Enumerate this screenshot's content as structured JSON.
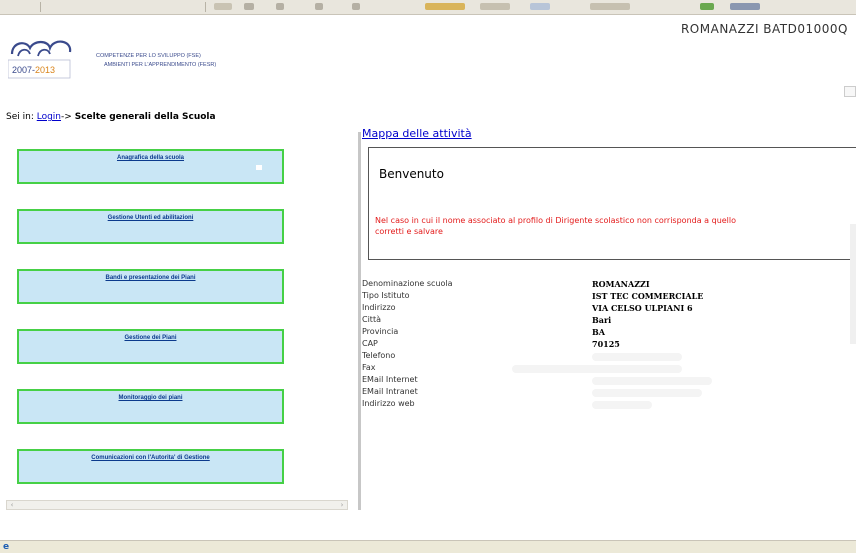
{
  "header": {
    "logo_years_a": "2007-",
    "logo_years_b": "2013",
    "logo_line1": "COMPETENZE PER LO SVILUPPO (FSE)",
    "logo_line2": "AMBIENTI PER L'APPRENDIMENTO (FESR)",
    "school_id": "ROMANAZZI BATD01000Q"
  },
  "breadcrumb": {
    "prefix": "Sei in:",
    "login": "Login",
    "arrow": "->",
    "current": "Scelte generali della Scuola"
  },
  "menu": {
    "items": [
      {
        "label": "Anagrafica della scuola"
      },
      {
        "label": "Gestione Utenti ed abilitazioni"
      },
      {
        "label": "Bandi e presentazione dei Piani"
      },
      {
        "label": "Gestione dei Piani"
      },
      {
        "label": "Monitoraggio dei piani"
      },
      {
        "label": "Comunicazioni con l'Autorita' di Gestione"
      }
    ]
  },
  "main": {
    "map_link": "Mappa delle attività",
    "welcome_title": "Benvenuto",
    "welcome_msg_line1": "Nel caso in cui il nome associato al profilo di Dirigente scolastico non corrisponda a quello",
    "welcome_msg_line2": "corretti e salvare"
  },
  "school_info": [
    {
      "label": "Denominazione scuola",
      "value": "ROMANAZZI"
    },
    {
      "label": "Tipo Istituto",
      "value": "IST TEC COMMERCIALE"
    },
    {
      "label": "Indirizzo",
      "value": "VIA CELSO ULPIANI 6"
    },
    {
      "label": "Città",
      "value": "Bari"
    },
    {
      "label": "Provincia",
      "value": "BA"
    },
    {
      "label": "CAP",
      "value": "70125"
    },
    {
      "label": "Telefono",
      "value": ""
    },
    {
      "label": "Fax",
      "value": ""
    },
    {
      "label": "EMail Internet",
      "value": ""
    },
    {
      "label": "EMail Intranet",
      "value": ""
    },
    {
      "label": "Indirizzo web",
      "value": ""
    }
  ],
  "colors": {
    "menu_bg": "#c9e6f5",
    "menu_border": "#46d046",
    "link": "#0000cc",
    "warning": "#e31b1b"
  },
  "icons": {
    "status": "ie-icon"
  }
}
